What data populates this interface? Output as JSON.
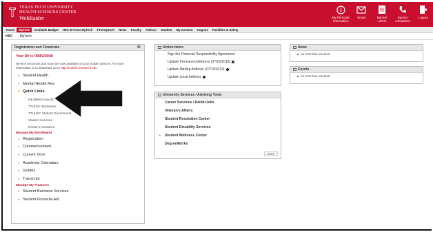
{
  "header": {
    "brand_line1": "TEXAS TECH UNIVERSITY",
    "brand_line2": "HEALTH SCIENCES CENTER",
    "brand_line3": "WebRaider",
    "items": [
      {
        "label": "My Personal Information",
        "icon": "info-icon"
      },
      {
        "label": "Email",
        "icon": "envelope-icon"
      },
      {
        "label": "Banner Admin",
        "icon": "calendar-icon"
      },
      {
        "label": "Banner Assistance",
        "icon": "phone-icon"
      },
      {
        "label": "Logout",
        "icon": "logout-icon"
      }
    ]
  },
  "nav": {
    "items": [
      "Home",
      "MyTech",
      "Available Budget",
      "HSC El Paso MyTech",
      "TTU MyTech",
      "News",
      "Faculty",
      "Advisor",
      "Student",
      "My Content",
      "Cognos",
      "Facilities & Safety"
    ],
    "active": "MyTech"
  },
  "subnav": {
    "items": [
      "HSC",
      "MyTech"
    ]
  },
  "left_panel": {
    "title": "Registration and Financials",
    "rnumber": "Your R# is R00523048",
    "info_text": "MyTech resources and more are now available on your mobile devices. For more information or to download, go to",
    "info_link": "http://mobile.texastech.edu",
    "items": [
      {
        "label": "Student Health"
      },
      {
        "label": "Mental Health Res"
      },
      {
        "label": "Quick Links"
      }
    ],
    "quick_links": [
      "Facilities/Grounds",
      "TTUHSC Bookstore",
      "TTUHSC Student Government",
      "Student Services",
      "Renter's Insurance"
    ],
    "group_enrollment": "Manage My Enrollment",
    "enrollment_items": [
      "Registration",
      "Commencement",
      "Current Term",
      "Academic Calendars",
      "Grades",
      "Transcript"
    ],
    "group_finances": "Manage My Finances",
    "finance_items": [
      "Student Business Services",
      "Student Financial Aid"
    ]
  },
  "action_items": {
    "title": "Action Items",
    "items": [
      "Sign the Financial Responsibility Agreement",
      "Update Permanent Address (07/16/2019)",
      "Update Mailing Address (07/16/2019)",
      "Update Local Address"
    ]
  },
  "university_services": {
    "title": "University Services / Advising Tools",
    "items": [
      "Career Services / RaiderJobs",
      "Veteran's Affairs",
      "Student Resolution Center",
      "Student Disability Services",
      "Student Wellness Center",
      "DegreeWorks"
    ],
    "more_label": "More"
  },
  "news": {
    "title": "News",
    "message": "An error has occurred"
  },
  "events": {
    "title": "Events",
    "message": "An error has occurred"
  },
  "colors": {
    "brand_red": "#c8102e",
    "bullet_orange": "#f0a030"
  }
}
